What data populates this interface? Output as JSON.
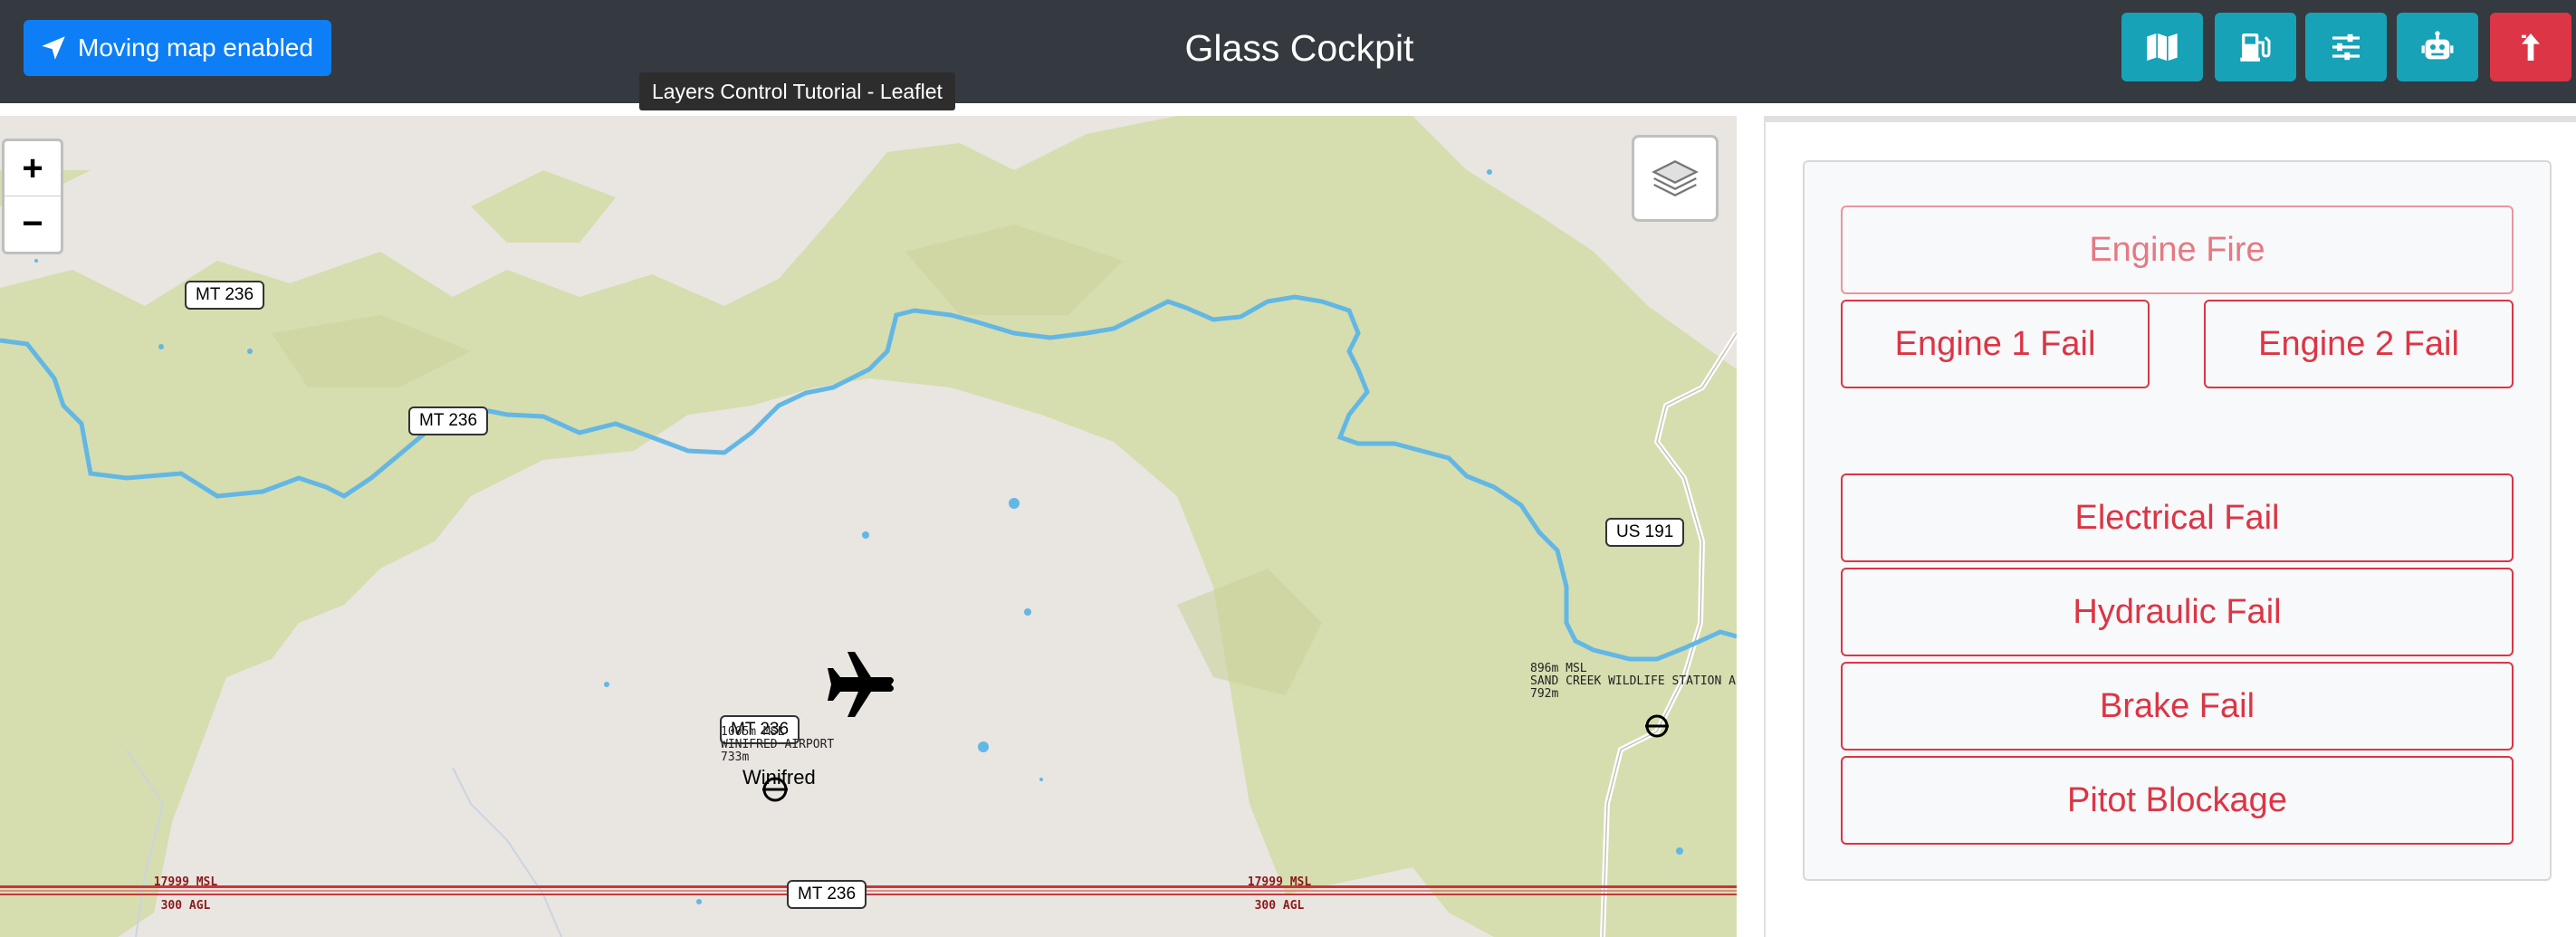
{
  "navbar": {
    "moving_map_label": "Moving map enabled",
    "title": "Glass Cockpit",
    "buttons": [
      {
        "name": "map-button",
        "icon": "map-icon"
      },
      {
        "name": "fuel-button",
        "icon": "gas-pump-icon"
      },
      {
        "name": "settings-button",
        "icon": "sliders-icon"
      },
      {
        "name": "autopilot-button",
        "icon": "robot-icon"
      },
      {
        "name": "eject-button",
        "icon": "eject-icon"
      }
    ],
    "colors": {
      "primary": "#0d7ef5",
      "info": "#17a2b8",
      "danger": "#dc3545",
      "bar": "#343a40"
    }
  },
  "tooltip": "Layers Control Tutorial - Leaflet",
  "map": {
    "zoom_in": "+",
    "zoom_out": "−",
    "road_labels": [
      "MT 236",
      "MT 236",
      "US 191",
      "MT 236",
      "MT 236"
    ],
    "winifred_airport": {
      "line1": "1005m MSL",
      "line2": "WINIFRED AIRPORT",
      "line3": "733m"
    },
    "sand_creek": {
      "line1": "896m MSL",
      "line2": "SAND CREEK WILDLIFE STATION A",
      "line3": "792m"
    },
    "town": "Winifred",
    "altitude_left": {
      "msl": "17999 MSL",
      "agl": "300 AGL"
    },
    "altitude_right": {
      "msl": "17999 MSL",
      "agl": "300 AGL"
    }
  },
  "failures": {
    "engine_fire": "Engine Fire",
    "engine1": "Engine 1 Fail",
    "engine2": "Engine 2 Fail",
    "electrical": "Electrical Fail",
    "hydraulic": "Hydraulic Fail",
    "brake": "Brake Fail",
    "pitot": "Pitot Blockage"
  }
}
